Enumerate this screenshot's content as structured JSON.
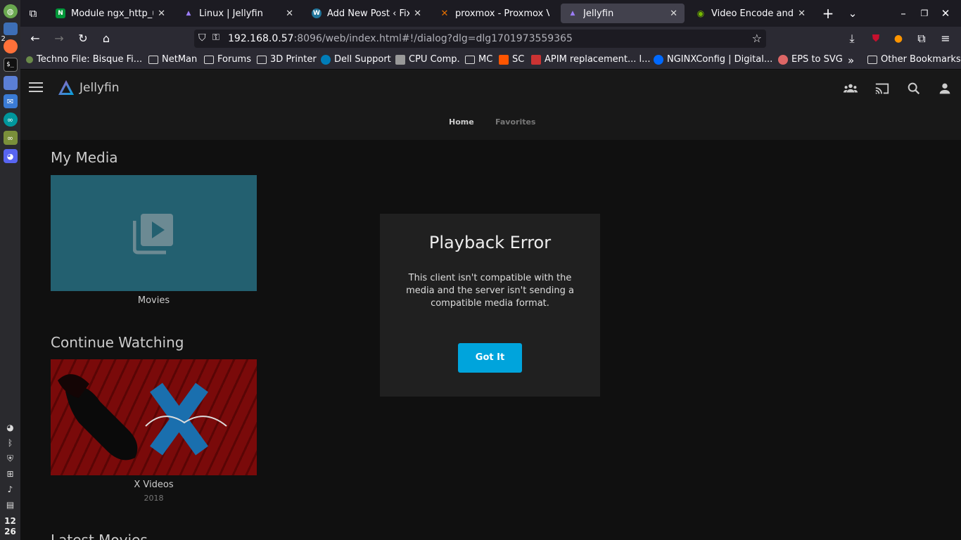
{
  "os": {
    "clock_hour": "12",
    "clock_min": "26",
    "workspace": "2"
  },
  "browser": {
    "tabs": [
      {
        "label": "Module ngx_http_up",
        "fav_color": "#009639",
        "fav_glyph": "N"
      },
      {
        "label": "Linux | Jellyfin",
        "fav_color": "#7b5cd6",
        "fav_glyph": "▲"
      },
      {
        "label": "Add New Post ‹ Fix It",
        "fav_color": "#21759b",
        "fav_glyph": "W"
      },
      {
        "label": "proxmox - Proxmox V",
        "fav_color": "#e57000",
        "fav_glyph": "✕"
      },
      {
        "label": "Jellyfin",
        "fav_color": "#7b5cd6",
        "fav_glyph": "▲"
      },
      {
        "label": "Video Encode and De",
        "fav_color": "#76b900",
        "fav_glyph": "◉"
      }
    ],
    "url_host": "192.168.0.57",
    "url_rest": ":8096/web/index.html#!/dialog?dlg=dlg1701973559365",
    "bookmarks": [
      "Techno File: Bisque Fi...",
      "NetMan",
      "Forums",
      "3D Printer",
      "Dell Support",
      "CPU Comp.",
      "MC",
      "SC",
      "APIM replacement... l...",
      "NGINXConfig | Digital...",
      "EPS to SVG",
      "Other Bookmarks"
    ]
  },
  "jellyfin": {
    "logo_text": "Jellyfin",
    "tabs": {
      "home": "Home",
      "favorites": "Favorites"
    },
    "my_media_title": "My Media",
    "movies_label": "Movies",
    "continue_watching_title": "Continue Watching",
    "cw_item_title": "X Videos",
    "cw_item_year": "2018",
    "latest_title": "Latest Movies",
    "colors": {
      "accent": "#00a4dc",
      "movies_card": "#236070"
    }
  },
  "dialog": {
    "title": "Playback Error",
    "message": "This client isn't compatible with the media and the server isn't sending a compatible media format.",
    "button": "Got It"
  }
}
